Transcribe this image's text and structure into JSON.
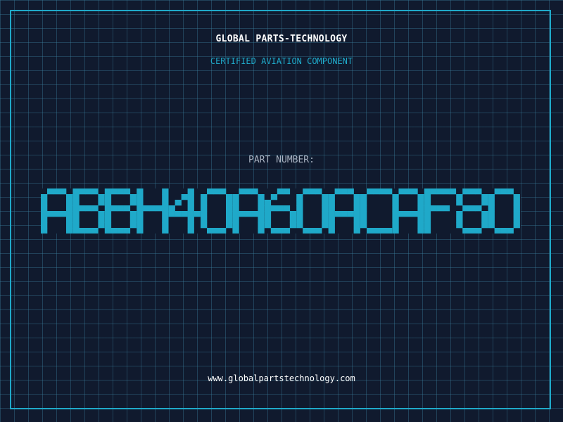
{
  "card": {
    "company": "GLOBAL PARTS-TECHNOLOGY",
    "subtitle": "CERTIFIED AVIATION COMPONENT",
    "part_number_label": "PART NUMBER:",
    "part_number": "ABBH40A60ACAF80",
    "website": "www.globalpartstechnology.com"
  },
  "colors": {
    "background": "#101a2e",
    "grid": "#2f6f87",
    "accent": "#1fa9c9",
    "text_primary": "#ffffff",
    "text_muted": "#a9b3c2"
  }
}
